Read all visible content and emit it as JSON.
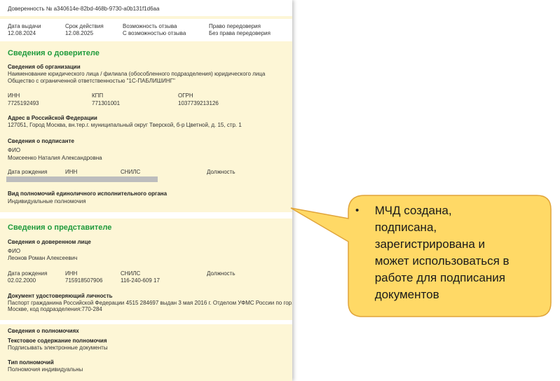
{
  "document": {
    "title": "Доверенность № a340614e-82bd-468b-9730-a0b131f1d6aa",
    "meta": {
      "issue_date_label": "Дата выдачи",
      "issue_date": "12.08.2024",
      "term_label": "Срок действия",
      "term": "12.08.2025",
      "revocation_label": "Возможность отзыва",
      "revocation": "С возможностью отзыва",
      "transfer_label": "Право передоверия",
      "transfer": "Без права передоверия"
    },
    "principal": {
      "heading": "Сведения о доверителе",
      "org": {
        "title": "Сведения об организации",
        "name_label": "Наименование юридического лица / филиала (обособленного подразделения) юридического лица",
        "name": "Общество с ограниченной ответственностью \"1С-ПАБЛИШИНГ\""
      },
      "inn_label": "ИНН",
      "inn": "7725192493",
      "kpp_label": "КПП",
      "kpp": "771301001",
      "ogrn_label": "ОГРН",
      "ogrn": "1037739213126",
      "address_title": "Адрес в Российской Федерации",
      "address": "127051, Город Москва, вн.тер.г. муниципальный округ Тверской, б-р Цветной, д. 15, стр. 1",
      "signer": {
        "title": "Сведения о подписанте",
        "fio_label": "ФИО",
        "fio": "Моисеенко Наталия Александровна",
        "birth_label": "Дата рождения",
        "inn_label": "ИНН",
        "snils_label": "СНИЛС",
        "position_label": "Должность"
      },
      "authority_title": "Вид полномочий единоличного исполнительного органа",
      "authority": "Индивидуальные полномочия"
    },
    "representative": {
      "heading": "Сведения о представителе",
      "person_title": "Сведения о доверенном лице",
      "fio_label": "ФИО",
      "fio": "Леонов Роман Алексеевич",
      "birth_label": "Дата рождения",
      "birth": "02.02.2000",
      "inn_label": "ИНН",
      "inn": "715918507906",
      "snils_label": "СНИЛС",
      "snils": "116-240-609 17",
      "position_label": "Должность",
      "id_doc_title": "Документ удостоверяющий личность",
      "id_doc_line1": "Паспорт гражданина Российской Федерации 4515 284697 выдан 3 мая 2016 г. Отделом УФМС России по гор.",
      "id_doc_line2": "Москве, код подразделения:770-284"
    },
    "powers": {
      "title": "Сведения о полномочиях",
      "text_title": "Текстовое содержание полномочия",
      "text": "Подписывать электронные документы",
      "type_title": "Тип полномочий",
      "type": "Полномочия индивидуальны"
    }
  },
  "callout": {
    "bullet": "•",
    "text": "МЧД создана,\nподписана,\nзарегистрирована и\nможет использоваться в\nработе для подписания\nдокументов",
    "fill_color": "#ffd966",
    "stroke_color": "#e0a43a"
  }
}
